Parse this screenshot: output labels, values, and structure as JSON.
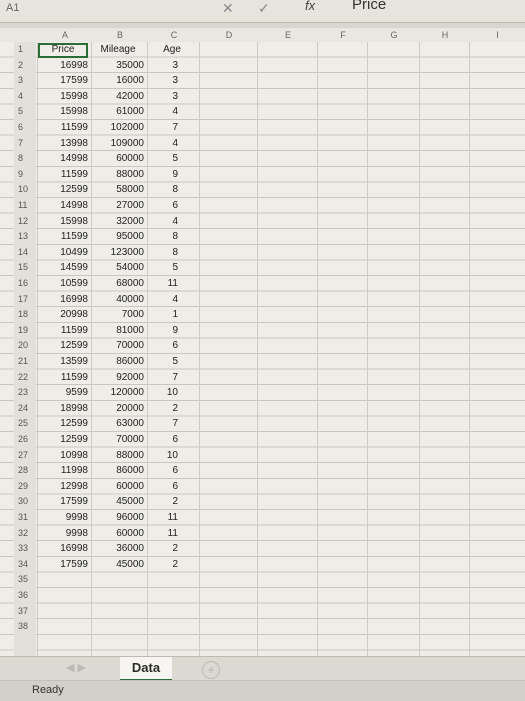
{
  "formula_bar": {
    "name_box": "A1",
    "cancel_glyph": "✕",
    "enter_glyph": "✓",
    "fx_label": "fx",
    "value": "Price"
  },
  "columns": [
    "A",
    "B",
    "C",
    "D",
    "E",
    "F",
    "G",
    "H",
    "I"
  ],
  "rows": [
    "1",
    "2",
    "3",
    "4",
    "5",
    "6",
    "7",
    "8",
    "9",
    "10",
    "11",
    "12",
    "13",
    "14",
    "15",
    "16",
    "17",
    "18",
    "19",
    "20",
    "21",
    "22",
    "23",
    "24",
    "25",
    "26",
    "27",
    "28",
    "29",
    "30",
    "31",
    "32",
    "33",
    "34",
    "35",
    "36",
    "37",
    "38"
  ],
  "headers": [
    "Price",
    "Mileage",
    "Age"
  ],
  "data": [
    [
      "16998",
      "35000",
      "3"
    ],
    [
      "17599",
      "16000",
      "3"
    ],
    [
      "15998",
      "42000",
      "3"
    ],
    [
      "15998",
      "61000",
      "4"
    ],
    [
      "11599",
      "102000",
      "7"
    ],
    [
      "13998",
      "109000",
      "4"
    ],
    [
      "14998",
      "60000",
      "5"
    ],
    [
      "11599",
      "88000",
      "9"
    ],
    [
      "12599",
      "58000",
      "8"
    ],
    [
      "14998",
      "27000",
      "6"
    ],
    [
      "15998",
      "32000",
      "4"
    ],
    [
      "11599",
      "95000",
      "8"
    ],
    [
      "10499",
      "123000",
      "8"
    ],
    [
      "14599",
      "54000",
      "5"
    ],
    [
      "10599",
      "68000",
      "11"
    ],
    [
      "16998",
      "40000",
      "4"
    ],
    [
      "20998",
      "7000",
      "1"
    ],
    [
      "11599",
      "81000",
      "9"
    ],
    [
      "12599",
      "70000",
      "6"
    ],
    [
      "13599",
      "86000",
      "5"
    ],
    [
      "11599",
      "92000",
      "7"
    ],
    [
      "9599",
      "120000",
      "10"
    ],
    [
      "18998",
      "20000",
      "2"
    ],
    [
      "12599",
      "63000",
      "7"
    ],
    [
      "12599",
      "70000",
      "6"
    ],
    [
      "10998",
      "88000",
      "10"
    ],
    [
      "11998",
      "86000",
      "6"
    ],
    [
      "12998",
      "60000",
      "6"
    ],
    [
      "17599",
      "45000",
      "2"
    ],
    [
      "9998",
      "96000",
      "11"
    ],
    [
      "9998",
      "60000",
      "11"
    ],
    [
      "16998",
      "36000",
      "2"
    ],
    [
      "17599",
      "45000",
      "2"
    ]
  ],
  "sheet_tabs": [
    {
      "label": "Data"
    }
  ],
  "add_sheet_glyph": "+",
  "status": "Ready"
}
